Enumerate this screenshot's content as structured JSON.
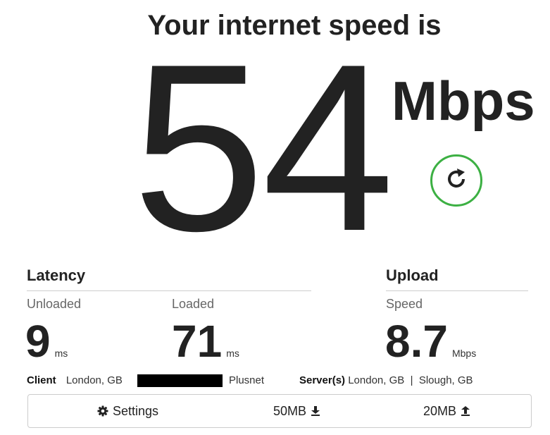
{
  "header": {
    "headline": "Your internet speed is"
  },
  "result": {
    "download_speed": "54",
    "unit": "Mbps",
    "refresh_icon": "refresh-icon",
    "accent_color": "#3cb043"
  },
  "latency": {
    "title": "Latency",
    "unloaded": {
      "label": "Unloaded",
      "value": "9",
      "unit": "ms"
    },
    "loaded": {
      "label": "Loaded",
      "value": "71",
      "unit": "ms"
    }
  },
  "upload": {
    "title": "Upload",
    "speed": {
      "label": "Speed",
      "value": "8.7",
      "unit": "Mbps"
    }
  },
  "client": {
    "label": "Client",
    "location": "London, GB",
    "isp": "Plusnet"
  },
  "servers": {
    "label": "Server(s)",
    "list": "London, GB  |  Slough, GB"
  },
  "footer": {
    "settings_label": "Settings",
    "settings_icon": "gear-icon",
    "download_size": "50MB",
    "download_icon": "download-arrow-icon",
    "upload_size": "20MB",
    "upload_icon": "upload-arrow-icon"
  }
}
